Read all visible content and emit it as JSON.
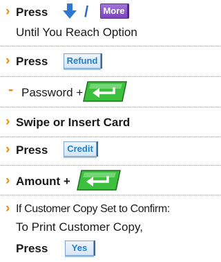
{
  "steps": [
    {
      "press": "Press",
      "slash": "/",
      "more_key": "More",
      "line2": "Until You Reach Option"
    },
    {
      "press": "Press",
      "key": "Refund"
    },
    {
      "text": "Password +"
    },
    {
      "text": "Swipe or Insert Card"
    },
    {
      "press": "Press",
      "key": "Credit"
    },
    {
      "text": "Amount +"
    },
    {
      "line1": "If Customer Copy Set to Confirm:",
      "line2": "To Print Customer Copy,",
      "press": "Press",
      "key": "Yes"
    }
  ],
  "icons": {
    "bullet": "chevron-right-icon",
    "down_arrow": "down-arrow-icon",
    "enter": "enter-key-icon"
  },
  "colors": {
    "bullet": "#f28c00",
    "key_text": "#1f7fcf",
    "enter_key": "#3cbf3c",
    "more_key": "#8a55c8"
  }
}
